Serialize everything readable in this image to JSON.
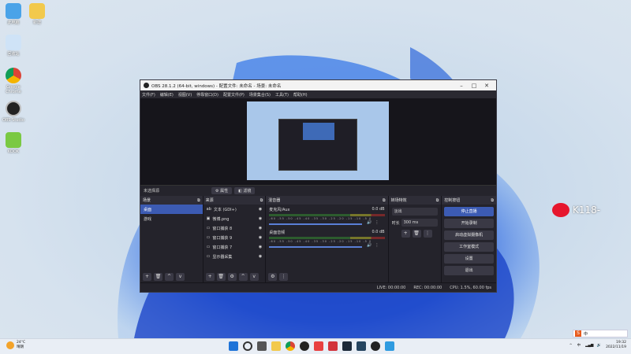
{
  "desktop": {
    "icons": [
      {
        "label": "此电脑",
        "name": "this-pc"
      },
      {
        "label": "新建",
        "name": "folder"
      },
      {
        "label": "回收站",
        "name": "recycle-bin"
      },
      {
        "label": "Google Chrome",
        "name": "chrome"
      },
      {
        "label": "OBS Studio",
        "name": "obs"
      },
      {
        "label": "KOOK",
        "name": "kook"
      }
    ]
  },
  "obs": {
    "title": "OBS 28.1.2 (64-bit, windows) - 配置文件: 未命名 - 场景: 未命名",
    "menu": [
      "文件(F)",
      "编辑(E)",
      "视图(V)",
      "停靠窗口(D)",
      "配置文件(P)",
      "场景集合(S)",
      "工具(T)",
      "帮助(H)"
    ],
    "source_bar": {
      "no_source": "未选择源",
      "properties": "属性",
      "filters": "滤镜"
    },
    "scenes": {
      "title": "场景",
      "items": [
        "桌面",
        "游戏"
      ]
    },
    "sources": {
      "title": "来源",
      "items": [
        "文本 (GDI+)",
        "微博.png",
        "窗口捕获 8",
        "窗口捕获 9",
        "窗口捕获 7",
        "显示器采集"
      ]
    },
    "mixer": {
      "title": "混音器",
      "tracks": [
        {
          "name": "麦克风/Aux",
          "level": "0.0 dB"
        },
        {
          "name": "桌面音频",
          "level": "0.0 dB"
        }
      ],
      "ticks": "-60 -55 -50 -45 -40 -35 -30 -25 -20 -15 -10 -5 0"
    },
    "transitions": {
      "title": "转场特效",
      "type": "淡出",
      "duration_label": "时长",
      "duration": "300 ms"
    },
    "controls": {
      "title": "控制按钮",
      "buttons": [
        "停止直播",
        "开始录制",
        "启动虚拟摄像机",
        "工作室模式",
        "设置",
        "退出"
      ]
    },
    "status": {
      "live": "LIVE: 00:00:00",
      "rec": "REC: 00:00:00",
      "cpu": "CPU: 1.5%, 60.00 fps"
    }
  },
  "watermark": {
    "text": "K118-"
  },
  "taskbar": {
    "weather_temp": "24°C",
    "weather_desc": "晴朗",
    "tray_text": "中",
    "time": "19:32",
    "date": "2022/11/19"
  },
  "ime": {
    "label": "中"
  }
}
